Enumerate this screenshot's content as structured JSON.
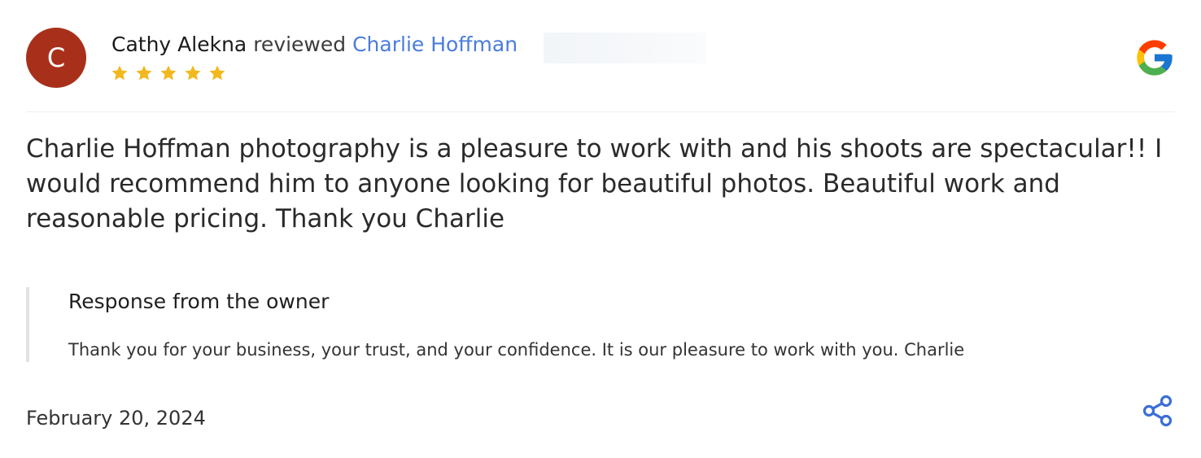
{
  "review": {
    "avatar_letter": "C",
    "avatar_color": "#a8301a",
    "reviewer_name": "Cathy Alekna",
    "reviewed_word": "reviewed",
    "business_name": "Charlie Hoffman",
    "rating": 5,
    "star_color": "#f2b81e",
    "text": "Charlie Hoffman photography is a pleasure to work with and his shoots are spectacular!! I would recommend him to anyone looking for beautiful photos. Beautiful work and reasonable pricing. Thank you Charlie",
    "date": "February 20, 2024"
  },
  "owner_response": {
    "title": "Response from the owner",
    "text": "Thank you for your business, your trust, and your confidence. It is our pleasure to work with you. Charlie"
  },
  "icons": {
    "source": "google-icon",
    "share": "share-icon"
  },
  "colors": {
    "link": "#4a7ddc",
    "share": "#3b6fd6"
  }
}
